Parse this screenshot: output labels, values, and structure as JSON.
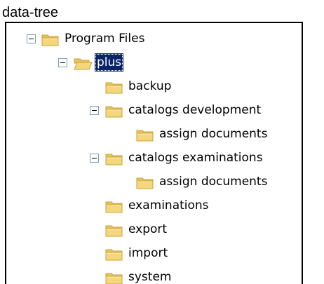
{
  "caption": "data-tree",
  "tree": {
    "items": [
      {
        "label": "Program Files",
        "expanded": true,
        "selected": false,
        "icon": "folder-icon",
        "depth": 0
      },
      {
        "label": "plus",
        "expanded": true,
        "selected": true,
        "icon": "folder-open-icon",
        "depth": 1
      },
      {
        "label": "backup",
        "expanded": false,
        "selected": false,
        "icon": "folder-icon",
        "depth": 2
      },
      {
        "label": "catalogs development",
        "expanded": true,
        "selected": false,
        "icon": "folder-icon",
        "depth": 2
      },
      {
        "label": "assign documents",
        "expanded": false,
        "selected": false,
        "icon": "folder-icon",
        "depth": 3
      },
      {
        "label": "catalogs examinations",
        "expanded": true,
        "selected": false,
        "icon": "folder-icon",
        "depth": 2
      },
      {
        "label": "assign documents",
        "expanded": false,
        "selected": false,
        "icon": "folder-icon",
        "depth": 3
      },
      {
        "label": "examinations",
        "expanded": false,
        "selected": false,
        "icon": "folder-icon",
        "depth": 2
      },
      {
        "label": "export",
        "expanded": false,
        "selected": false,
        "icon": "folder-icon",
        "depth": 2
      },
      {
        "label": "import",
        "expanded": false,
        "selected": false,
        "icon": "folder-icon",
        "depth": 2
      },
      {
        "label": "system",
        "expanded": false,
        "selected": false,
        "icon": "folder-icon",
        "depth": 2
      }
    ]
  },
  "colors": {
    "selection_background": "#0a246a",
    "selection_text": "#ffffff",
    "toggle_border": "#7f9db9",
    "folder_fill": "#f5d77b",
    "folder_outline": "#c9a03a"
  }
}
